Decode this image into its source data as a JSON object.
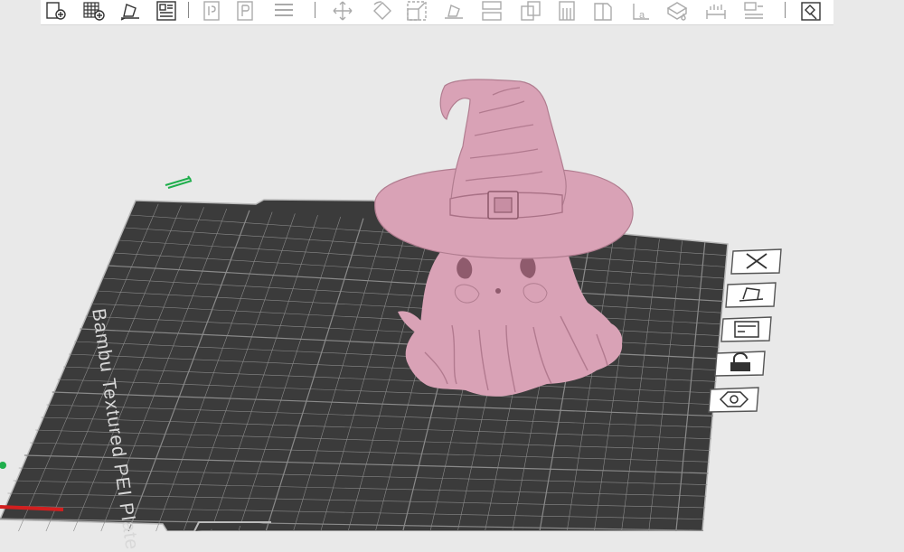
{
  "plate": {
    "label": "Bambu Textured PEI Plate",
    "color": "#3b3b3b",
    "grid_color": "#8a8a8a"
  },
  "model": {
    "color": "#d9a2b6"
  },
  "toolbar": {
    "items": [
      {
        "name": "add-object-icon"
      },
      {
        "name": "add-plate-icon"
      },
      {
        "name": "orient-icon"
      },
      {
        "name": "arrange-icon"
      },
      {
        "name": "split-objects-icon"
      },
      {
        "name": "split-parts-icon"
      },
      {
        "name": "layers-icon"
      },
      {
        "name": "move-icon"
      },
      {
        "name": "rotate-icon"
      },
      {
        "name": "scale-icon"
      },
      {
        "name": "lay-on-face-icon"
      },
      {
        "name": "cut-icon"
      },
      {
        "name": "boolean-icon"
      },
      {
        "name": "support-paint-icon"
      },
      {
        "name": "seam-paint-icon"
      },
      {
        "name": "text-icon"
      },
      {
        "name": "color-paint-icon"
      },
      {
        "name": "measure-icon"
      },
      {
        "name": "assembly-icon"
      },
      {
        "name": "assembly-view-icon"
      }
    ]
  },
  "side_buttons": [
    {
      "name": "close-plate-icon"
    },
    {
      "name": "auto-orient-plate-icon"
    },
    {
      "name": "arrange-plate-icon"
    },
    {
      "name": "lock-plate-icon"
    },
    {
      "name": "plate-settings-icon"
    }
  ]
}
